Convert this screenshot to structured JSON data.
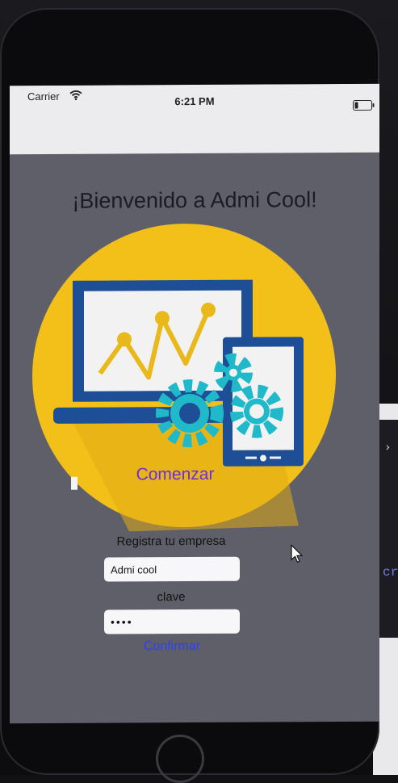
{
  "status_bar": {
    "carrier": "Carrier",
    "time": "6:21 PM",
    "wifi_icon": "wifi-icon",
    "battery_icon": "battery-icon"
  },
  "welcome": {
    "title": "¡Bienvenido a Admi Cool!"
  },
  "hero": {
    "illustration_icon": "devices-analytics-gears-illustration",
    "circle_color": "#f3c01a",
    "device_frame_color": "#1e4f96",
    "gear_color": "#1fb9c9"
  },
  "actions": {
    "start_label": "Comenzar"
  },
  "form": {
    "company_label": "Registra tu empresa",
    "company_value": "Admi cool",
    "password_label": "clave",
    "password_value": "••••",
    "confirm_label": "Confirmar"
  },
  "desktop": {
    "side_text": "cri"
  },
  "colors": {
    "screen_background": "#5f5f6a",
    "start_color": "#6a2ee0",
    "confirm_color": "#2f3ff5"
  }
}
